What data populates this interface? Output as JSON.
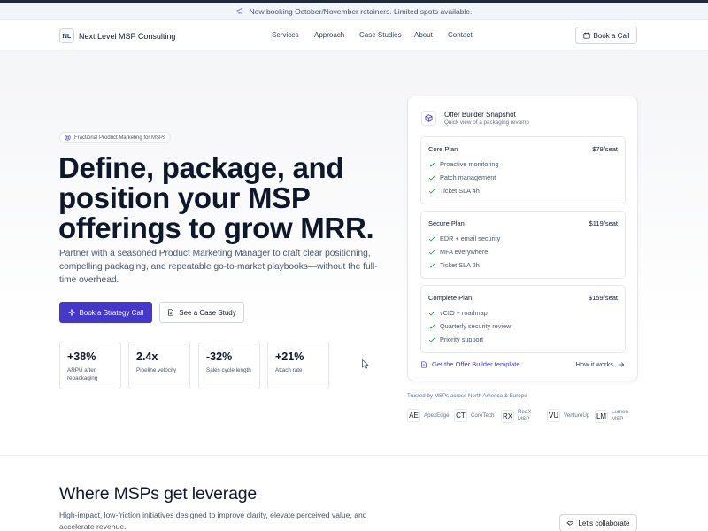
{
  "announcement": "Now booking October/November retainers. Limited spots available.",
  "brand": {
    "mark": "NL",
    "name": "Next Level MSP Consulting"
  },
  "nav": {
    "links": [
      "Services",
      "Approach",
      "Case Studies",
      "About",
      "Contact"
    ],
    "cta": "Book a Call"
  },
  "hero": {
    "pill": "Fractional Product Marketing for MSPs",
    "headline": [
      "Define, package, and",
      "position your MSP",
      "offerings to grow MRR."
    ],
    "subcopy": "Partner with a seasoned Product Marketing Manager to craft clear positioning, compelling packaging, and repeatable go-to-market playbooks—without the full-time overhead.",
    "primary_cta": "Book a Strategy Call",
    "secondary_cta": "See a Case Study",
    "stats": [
      {
        "value": "+38%",
        "label": "ARPU after repackaging"
      },
      {
        "value": "2.4x",
        "label": "Pipeline velocity"
      },
      {
        "value": "-32%",
        "label": "Sales cycle length"
      },
      {
        "value": "+21%",
        "label": "Attach rate"
      }
    ]
  },
  "snapshot": {
    "title": "Offer Builder Snapshot",
    "subtitle": "Quick view of a packaging revamp",
    "plans": [
      {
        "name": "Core Plan",
        "price": "$79/seat",
        "features": [
          "Proactive monitoring",
          "Patch management",
          "Ticket SLA 4h"
        ]
      },
      {
        "name": "Secure Plan",
        "price": "$119/seat",
        "features": [
          "EDR + email security",
          "MFA everywhere",
          "Ticket SLA 2h"
        ]
      },
      {
        "name": "Complete Plan",
        "price": "$159/seat",
        "features": [
          "vCIO + roadmap",
          "Quarterly security review",
          "Priority support"
        ]
      }
    ],
    "template_link": "Get the Offer Builder template",
    "how_link": "How it works"
  },
  "trusted": {
    "label": "Trusted by MSPs across North America & Europe",
    "logos": [
      {
        "mark": "AE",
        "name": "ApexEdge"
      },
      {
        "mark": "CT",
        "name": "CoreTech"
      },
      {
        "mark": "RX",
        "name": "RedX MSP"
      },
      {
        "mark": "VU",
        "name": "VentureUp"
      },
      {
        "mark": "LM",
        "name": "Lumen MSP"
      }
    ]
  },
  "leverage": {
    "title": "Where MSPs get leverage",
    "copy": "High-impact, low-friction initiatives designed to improve clarity, elevate perceived value, and accelerate revenue.",
    "cta": "Let's collaborate"
  },
  "colors": {
    "accent": "#4338ca",
    "check": "#16a34a",
    "text": "#0f172a",
    "muted": "#475569"
  }
}
